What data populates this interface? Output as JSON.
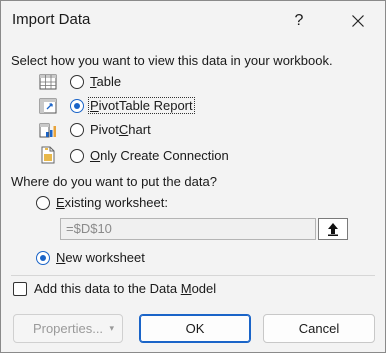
{
  "dialog": {
    "title": "Import Data",
    "help": "?",
    "prompt": "Select how you want to view this data in your workbook.",
    "view_options": [
      {
        "pre": "",
        "ul": "T",
        "post": "able",
        "icon": "table-icon",
        "checked": false
      },
      {
        "pre": "",
        "ul": "P",
        "post": "ivotTable Report",
        "icon": "pivottable-icon",
        "checked": true
      },
      {
        "pre": "Pivot",
        "ul": "C",
        "post": "hart",
        "icon": "pivotchart-icon",
        "checked": false
      },
      {
        "pre": "",
        "ul": "O",
        "post": "nly Create Connection",
        "icon": "connection-icon",
        "checked": false
      }
    ],
    "where_prompt": "Where do you want to put the data?",
    "location_options": [
      {
        "pre": "",
        "ul": "E",
        "post": "xisting worksheet:",
        "checked": false
      },
      {
        "pre": "",
        "ul": "N",
        "post": "ew worksheet",
        "checked": true
      }
    ],
    "reference_value": "=$D$10",
    "data_model": {
      "pre": "Add this data to the Data ",
      "ul": "M",
      "post": "odel",
      "checked": false
    },
    "buttons": {
      "properties": "Properties...",
      "ok": "OK",
      "cancel": "Cancel"
    }
  }
}
